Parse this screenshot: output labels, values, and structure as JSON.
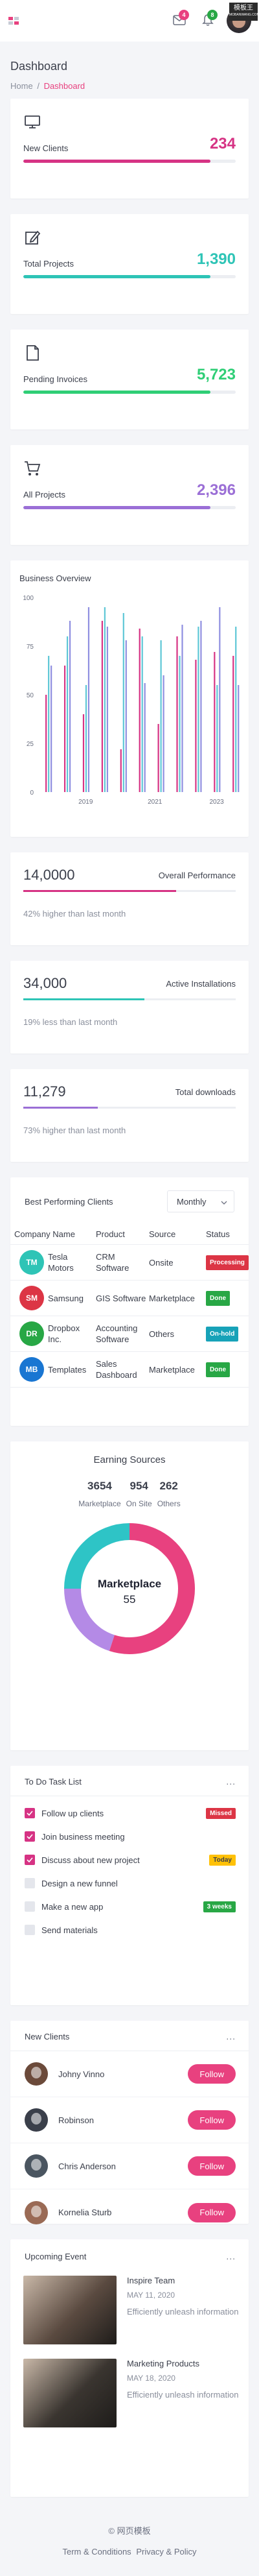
{
  "topbar": {
    "mail_badge": "4",
    "bell_badge": "8",
    "watermark_top": "模板王",
    "watermark_bottom": "MOBANWANG.COM"
  },
  "page": {
    "title": "Dashboard",
    "breadcrumb": [
      "Home",
      "/",
      "Dashboard"
    ]
  },
  "stats": [
    {
      "icon": "monitor-icon",
      "label": "New Clients",
      "value": "234",
      "color": "#d63384",
      "progress": 0.88
    },
    {
      "icon": "edit-icon",
      "label": "Total Projects",
      "value": "1,390",
      "color": "#2ec4b6",
      "progress": 0.88
    },
    {
      "icon": "file-icon",
      "label": "Pending Invoices",
      "value": "5,723",
      "color": "#2fce76",
      "progress": 0.88
    },
    {
      "icon": "cart-icon",
      "label": "All Projects",
      "value": "2,396",
      "color": "#9b6fd6",
      "progress": 0.88
    }
  ],
  "chart_data": {
    "type": "bar",
    "title": "Business Overview",
    "xlabel": "",
    "ylabel": "",
    "x_ticks": [
      "2019",
      "2021",
      "2023"
    ],
    "ylim": [
      0,
      100
    ],
    "y_ticks": [
      "0",
      "25",
      "50",
      "75",
      "100"
    ],
    "groups": [
      {
        "values": [
          50,
          70,
          65
        ]
      },
      {
        "values": [
          65,
          80,
          88
        ]
      },
      {
        "values": [
          40,
          55,
          95
        ]
      },
      {
        "values": [
          88,
          95,
          85
        ]
      },
      {
        "values": [
          22,
          92,
          78
        ]
      },
      {
        "values": [
          84,
          80,
          56
        ]
      },
      {
        "values": [
          35,
          78,
          60
        ]
      },
      {
        "values": [
          80,
          70,
          86
        ]
      },
      {
        "values": [
          68,
          85,
          88
        ]
      },
      {
        "values": [
          72,
          55,
          95
        ]
      },
      {
        "values": [
          70,
          85,
          55
        ]
      }
    ],
    "series_colors": [
      "#d63384",
      "#5ec7d6",
      "#8f8fe0"
    ]
  },
  "performance": [
    {
      "num": "14,0000",
      "title": "Overall Performance",
      "sub": "42% higher than last month",
      "color": "#d63384",
      "progress": 0.72
    },
    {
      "num": "34,000",
      "title": "Active Installations",
      "sub": "19% less than last month",
      "color": "#2ec4b6",
      "progress": 0.57
    },
    {
      "num": "11,279",
      "title": "Total downloads",
      "sub": "73% higher than last month",
      "color": "#9b6fd6",
      "progress": 0.35
    }
  ],
  "table": {
    "title": "Best Performing Clients",
    "period": "Monthly",
    "columns": [
      "Company Name",
      "Product",
      "Source",
      "Status"
    ],
    "rows": [
      {
        "initials": "TM",
        "color": "#2ec4b6",
        "company": "Tesla Motors",
        "product": "CRM Software",
        "source": "Onsite",
        "status": "Processing",
        "status_color": "#dc3545"
      },
      {
        "initials": "SM",
        "color": "#dc3545",
        "company": "Samsung",
        "product": "GIS Software",
        "source": "Marketplace",
        "status": "Done",
        "status_color": "#28a745"
      },
      {
        "initials": "DR",
        "color": "#28a745",
        "company": "Dropbox Inc.",
        "product": "Accounting Software",
        "source": "Others",
        "status": "On-hold",
        "status_color": "#17a2b8"
      },
      {
        "initials": "MB",
        "color": "#1976d2",
        "company": "Templates",
        "product": "Sales Dashboard",
        "source": "Marketplace",
        "status": "Done",
        "status_color": "#28a745"
      }
    ]
  },
  "earning": {
    "title": "Earning Sources",
    "stats": [
      {
        "value": "3654",
        "label": "Marketplace"
      },
      {
        "value": "954",
        "label": "On Site"
      },
      {
        "value": "262",
        "label": "Others"
      }
    ],
    "center_label": "Marketplace",
    "center_value": "55",
    "slices": [
      {
        "name": "Marketplace",
        "value": 55,
        "color": "#e8417f"
      },
      {
        "name": "Others",
        "value": 20,
        "color": "#b48ae6"
      },
      {
        "name": "On Site",
        "value": 25,
        "color": "#2ec4c6"
      }
    ]
  },
  "todo": {
    "title": "To Do Task List",
    "more": "...",
    "items": [
      {
        "label": "Follow up clients",
        "checked": true,
        "tag": "Missed",
        "tag_color": "#dc3545",
        "tag_text": "#ffffff"
      },
      {
        "label": "Join business meeting",
        "checked": true,
        "tag": "",
        "tag_color": "",
        "tag_text": ""
      },
      {
        "label": "Discuss about new project",
        "checked": true,
        "tag": "Today",
        "tag_color": "#ffc107",
        "tag_text": "#3b3f4b"
      },
      {
        "label": "Design a new funnel",
        "checked": false,
        "tag": "",
        "tag_color": "",
        "tag_text": ""
      },
      {
        "label": "Make a new app",
        "checked": false,
        "tag": "3 weeks",
        "tag_color": "#28a745",
        "tag_text": "#ffffff"
      },
      {
        "label": "Send materials",
        "checked": false,
        "tag": "",
        "tag_color": "",
        "tag_text": ""
      }
    ]
  },
  "clients": {
    "title": "New Clients",
    "more": "...",
    "follow_label": "Follow",
    "items": [
      {
        "name": "Johny Vinno",
        "color": "#6b4a3a"
      },
      {
        "name": "Robinson",
        "color": "#3a3f4a"
      },
      {
        "name": "Chris Anderson",
        "color": "#4a5560"
      },
      {
        "name": "Kornelia Sturb",
        "color": "#9a6a55"
      }
    ]
  },
  "events": {
    "title": "Upcoming Event",
    "more": "...",
    "items": [
      {
        "title": "Inspire Team",
        "date": "MAY 11, 2020",
        "text": "Efficiently unleash information",
        "bg": "#5a4a40"
      },
      {
        "title": "Marketing Products",
        "date": "MAY 18, 2020",
        "text": "Efficiently unleash information",
        "bg": "#3a3530"
      }
    ]
  },
  "footer": {
    "copyright": "© 网页模板",
    "links": [
      "Term & Conditions",
      "Privacy & Policy"
    ]
  }
}
